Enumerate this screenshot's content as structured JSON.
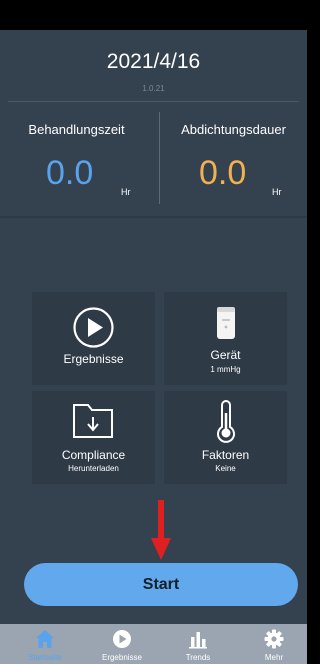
{
  "header": {
    "date": "2021/4/16",
    "version": "1.0.21"
  },
  "stats": {
    "left": {
      "label": "Behandlungszeit",
      "value": "0.0",
      "unit": "Hr"
    },
    "right": {
      "label": "Abdichtungsdauer",
      "value": "0.0",
      "unit": "Hr"
    }
  },
  "tiles": {
    "results": {
      "label": "Ergebnisse",
      "icon": "play-circle-icon"
    },
    "device": {
      "label": "Gerät",
      "sub": "1 mmHg",
      "icon": "device-icon"
    },
    "compliance": {
      "label": "Compliance",
      "sub": "Herunterladen",
      "icon": "folder-download-icon"
    },
    "factors": {
      "label": "Faktoren",
      "sub": "Keine",
      "icon": "thermometer-icon"
    }
  },
  "start_button": {
    "label": "Start"
  },
  "tabbar": {
    "items": [
      {
        "label": "Startseite",
        "icon": "home-icon",
        "active": true
      },
      {
        "label": "Ergebnisse",
        "icon": "play-icon",
        "active": false
      },
      {
        "label": "Trends",
        "icon": "bar-chart-icon",
        "active": false
      },
      {
        "label": "Mehr",
        "icon": "gear-icon",
        "active": false
      }
    ]
  },
  "colors": {
    "background": "#34414f",
    "tile": "#2e3a46",
    "accent_blue": "#5aa3ea",
    "accent_orange": "#f2b050",
    "start_button": "#61a8ec",
    "arrow": "#e02020",
    "tabbar": "#9aa5b1"
  }
}
